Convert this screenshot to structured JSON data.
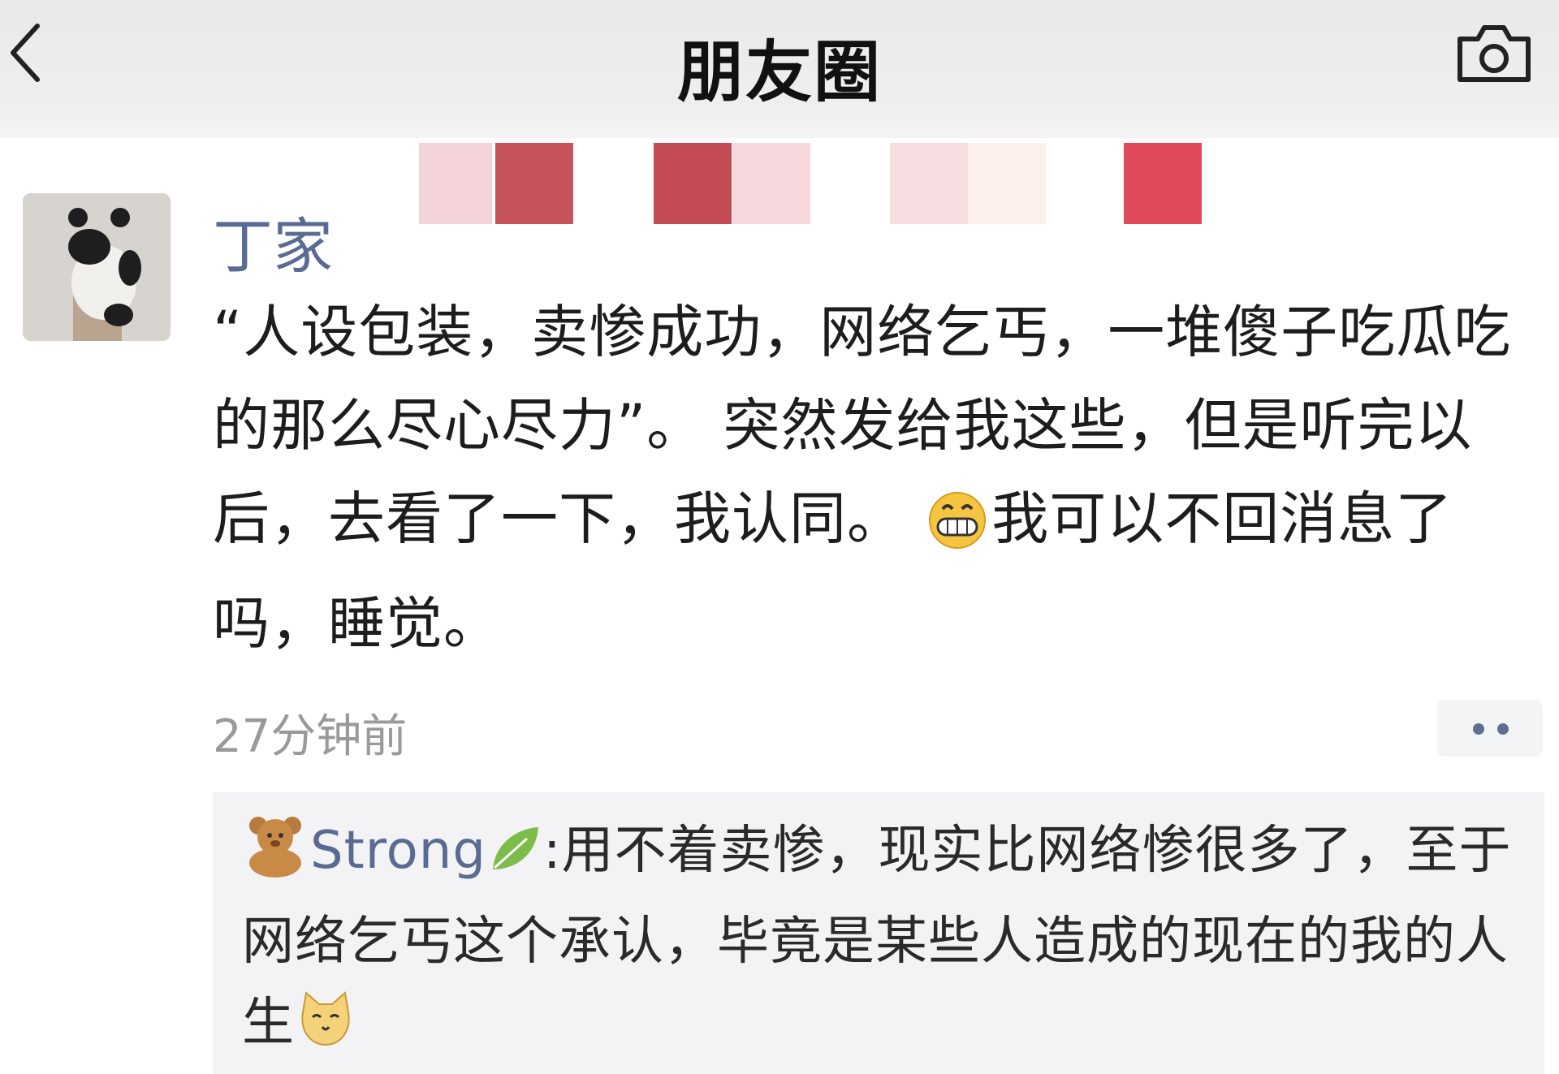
{
  "header": {
    "title": "朋友圈",
    "back_icon": "chevron-left-icon",
    "camera_icon": "camera-icon"
  },
  "post": {
    "username": "丁家",
    "text_part1": "“人设包装，卖惨成功，网络乞丐，一堆傻子吃瓜吃的那么尽心尽力”。 突然发给我这些，但是听完以后，去看了一下，我认同。",
    "emoji": "grinning-face-icon",
    "text_part2": "我可以不回消息了吗，睡觉。",
    "timestamp": "27分钟前",
    "more_icon": "more-dots-icon"
  },
  "comment": {
    "prefix_icon": "teddy-bear-icon",
    "author": "Strong",
    "suffix_icon": "leaf-icon",
    "separator": ":",
    "text": "用不着卖惨，现实比网络惨很多了，至于网络乞丐这个承认，毕竟是某些人造成的现在的我的人生",
    "end_icon": "cat-face-icon"
  },
  "colors": {
    "link_blue": "#5a6b93",
    "header_bg": "#ececec",
    "comment_bg": "#f3f3f5",
    "timestamp_gray": "#9a9a9a"
  }
}
